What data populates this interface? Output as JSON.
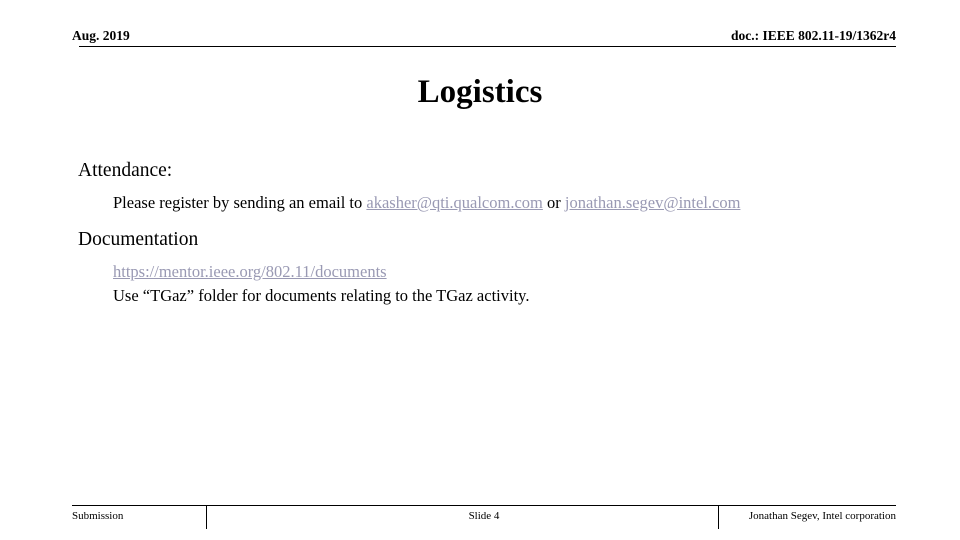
{
  "header": {
    "date": "Aug. 2019",
    "doc": "doc.: IEEE 802.11-19/1362r4"
  },
  "title": "Logistics",
  "content": {
    "attendance_heading": "Attendance:",
    "attendance_line_prefix": "Please register by sending an email to ",
    "attendance_email_1": "akasher@qti.qualcom.com",
    "attendance_line_sep": "  or ",
    "attendance_email_2": "jonathan.segev@intel.com",
    "documentation_heading": "Documentation",
    "documentation_link": "https://mentor.ieee.org/802.11/documents",
    "documentation_note": "Use “TGaz” folder for documents relating to the TGaz activity."
  },
  "footer": {
    "left": "Submission",
    "center": "Slide 4",
    "right": "Jonathan Segev, Intel corporation"
  },
  "colors": {
    "link": "#9999b3",
    "text": "#000000",
    "background": "#ffffff"
  }
}
